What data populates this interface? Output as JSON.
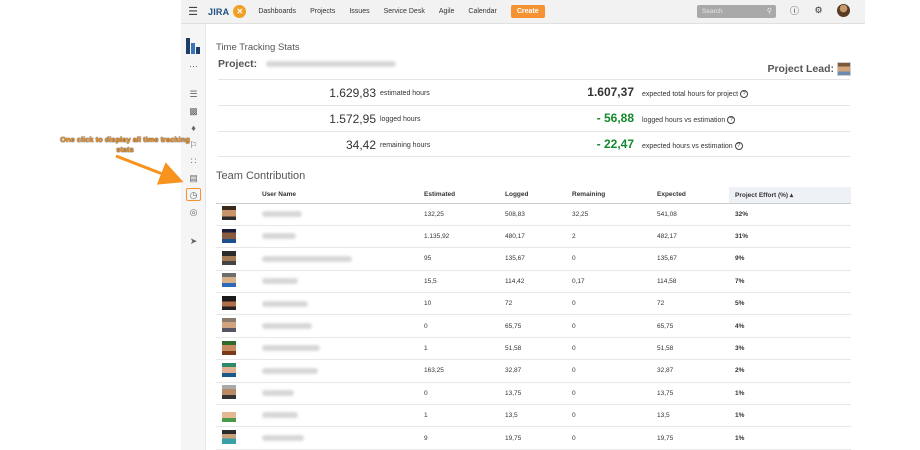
{
  "topbar": {
    "logo_text": "JIRA",
    "nav": [
      "Dashboards",
      "Projects",
      "Issues",
      "Service Desk",
      "Agile",
      "Calendar"
    ],
    "create_label": "Create",
    "search_placeholder": "Search"
  },
  "annotation": {
    "text": "One click to display all time tracking stats",
    "color": "#f7931e"
  },
  "main": {
    "title": "Time Tracking Stats",
    "project_label": "Project:",
    "project_lead_label": "Project Lead:"
  },
  "stats": [
    {
      "value": "1.629,83",
      "label": "estimated hours",
      "value2": "1.607,37",
      "label2": "expected total hours for project",
      "value2_color": "#333333"
    },
    {
      "value": "1.572,95",
      "label": "logged hours",
      "value2": "- 56,88",
      "label2": "logged hours vs estimation",
      "value2_color": "#14892c"
    },
    {
      "value": "34,42",
      "label": "remaining hours",
      "value2": "- 22,47",
      "label2": "expected hours vs estimation",
      "value2_color": "#14892c"
    }
  ],
  "team": {
    "title": "Team Contribution",
    "columns": [
      "",
      "User Name",
      "Estimated",
      "Logged",
      "Remaining",
      "Expected",
      "Project Effort (%) ▴"
    ],
    "rows": [
      {
        "estimated": "132,25",
        "logged": "508,83",
        "remaining": "32,25",
        "expected": "541,08",
        "effort": "32%"
      },
      {
        "estimated": "1.135,92",
        "logged": "480,17",
        "remaining": "2",
        "expected": "482,17",
        "effort": "31%"
      },
      {
        "estimated": "95",
        "logged": "135,67",
        "remaining": "0",
        "expected": "135,67",
        "effort": "9%"
      },
      {
        "estimated": "15,5",
        "logged": "114,42",
        "remaining": "0,17",
        "expected": "114,58",
        "effort": "7%"
      },
      {
        "estimated": "10",
        "logged": "72",
        "remaining": "0",
        "expected": "72",
        "effort": "5%"
      },
      {
        "estimated": "0",
        "logged": "65,75",
        "remaining": "0",
        "expected": "65,75",
        "effort": "4%"
      },
      {
        "estimated": "1",
        "logged": "51,58",
        "remaining": "0",
        "expected": "51,58",
        "effort": "3%"
      },
      {
        "estimated": "163,25",
        "logged": "32,87",
        "remaining": "0",
        "expected": "32,87",
        "effort": "2%"
      },
      {
        "estimated": "0",
        "logged": "13,75",
        "remaining": "0",
        "expected": "13,75",
        "effort": "1%"
      },
      {
        "estimated": "1",
        "logged": "13,5",
        "remaining": "0",
        "expected": "13,5",
        "effort": "1%"
      },
      {
        "estimated": "9",
        "logged": "19,75",
        "remaining": "0",
        "expected": "19,75",
        "effort": "1%"
      }
    ]
  },
  "colors": {
    "accent": "#f79232",
    "brand": "#205081",
    "positive": "#14892c"
  },
  "icons": [
    "menu-icon",
    "help-icon",
    "settings-icon",
    "user-avatar",
    "project-avatar",
    "more-icon",
    "backlog-icon",
    "reports-icon",
    "components-icon",
    "releases-icon",
    "apps-icon",
    "issues-icon",
    "time-tracking-icon",
    "settings-icon",
    "feedback-icon"
  ]
}
